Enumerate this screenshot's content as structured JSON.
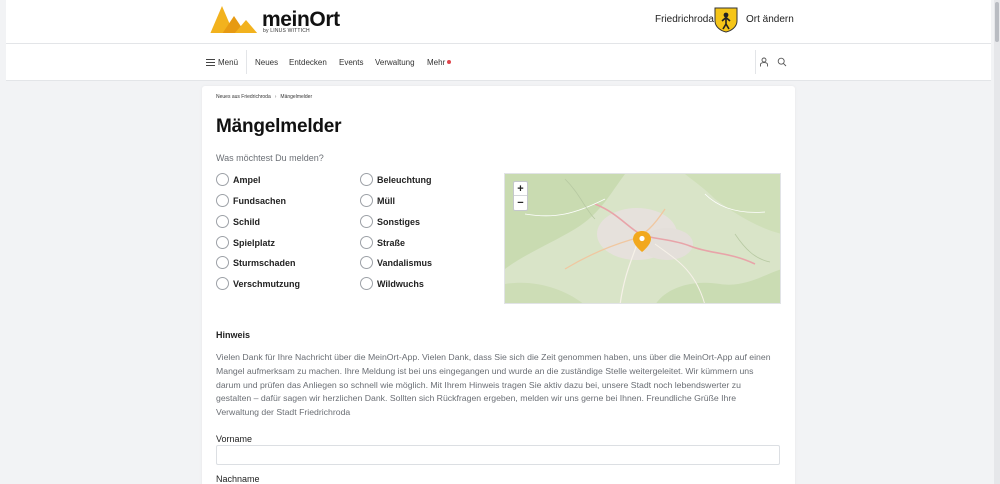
{
  "header": {
    "logo_name": "meinOrt",
    "logo_byline": "by LINUS WITTICH",
    "city": "Friedrichroda",
    "change_location": "Ort ändern"
  },
  "nav": {
    "menu": "Menü",
    "items": [
      "Neues",
      "Entdecken",
      "Events",
      "Verwaltung",
      "Mehr"
    ]
  },
  "breadcrumb": {
    "parent": "Neues aus Friedrichroda",
    "current": "Mängelmelder"
  },
  "page_title": "Mängelmelder",
  "question": "Was möchtest Du melden?",
  "options": {
    "left": [
      "Ampel",
      "Fundsachen",
      "Schild",
      "Spielplatz",
      "Sturmschaden",
      "Verschmutzung"
    ],
    "right": [
      "Beleuchtung",
      "Müll",
      "Sonstiges",
      "Straße",
      "Vandalismus",
      "Wildwuchs"
    ]
  },
  "map": {
    "zoom_in": "+",
    "zoom_out": "−"
  },
  "hint": {
    "title": "Hinweis",
    "text": "Vielen Dank für Ihre Nachricht über die MeinOrt-App. Vielen Dank, dass Sie sich die Zeit genommen haben, uns über die MeinOrt-App auf einen Mangel aufmerksam zu machen. Ihre Meldung ist bei uns eingegangen und wurde an die zuständige Stelle weitergeleitet. Wir kümmern uns darum und prüfen das Anliegen so schnell wie möglich. Mit Ihrem Hinweis tragen Sie aktiv dazu bei, unsere Stadt noch lebendswerter zu gestalten – dafür sagen wir herzlichen Dank. Sollten sich Rückfragen ergeben, melden wir uns gerne bei Ihnen. Freundliche Grüße Ihre Verwaltung der Stadt Friedrichroda"
  },
  "form": {
    "first_name_label": "Vorname",
    "first_name_value": "",
    "last_name_label": "Nachname"
  },
  "colors": {
    "accent_yellow": "#f2b21e",
    "notification_dot": "#e0454c",
    "map_marker": "#f2a81d"
  }
}
